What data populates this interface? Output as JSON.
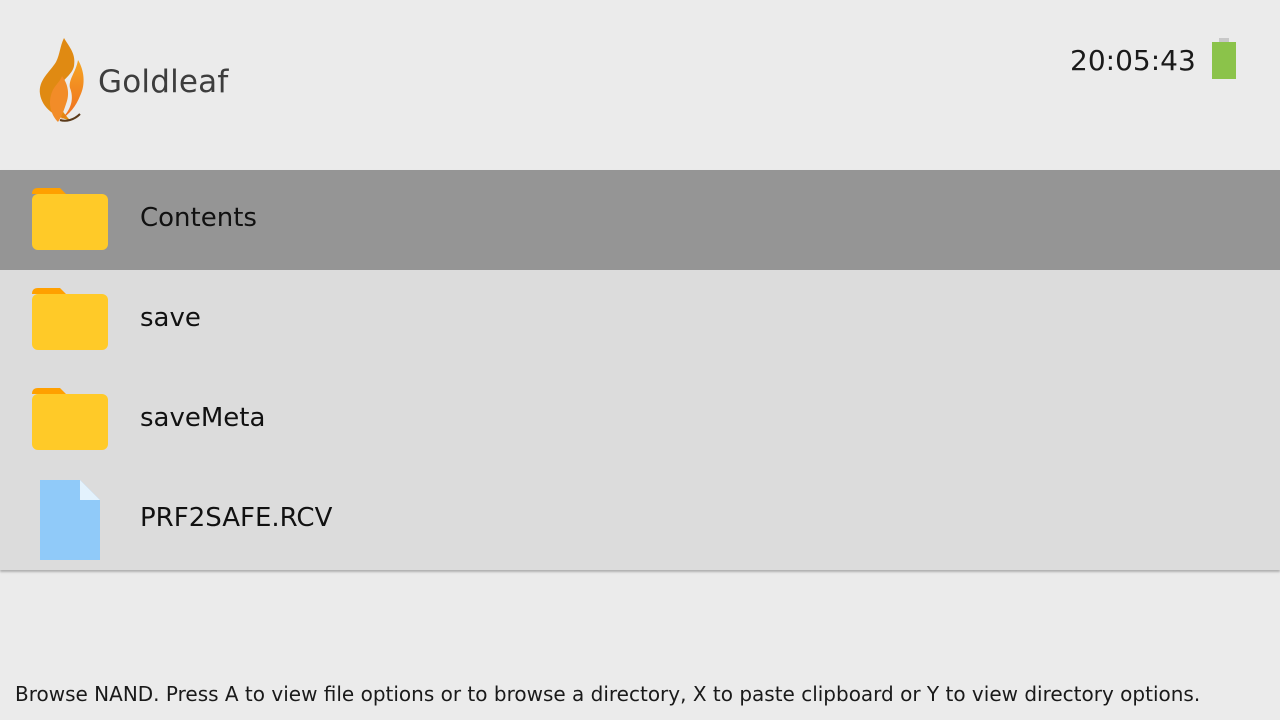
{
  "header": {
    "app_title": "Goldleaf",
    "logo_icon": "goldleaf-flame-logo",
    "clock": "20:05:43",
    "battery_icon": "battery-full-icon",
    "battery_color": "#8bc34a"
  },
  "browser": {
    "items": [
      {
        "name": "Contents",
        "type": "folder",
        "icon": "folder-icon",
        "selected": true
      },
      {
        "name": "save",
        "type": "folder",
        "icon": "folder-icon",
        "selected": false
      },
      {
        "name": "saveMeta",
        "type": "folder",
        "icon": "folder-icon",
        "selected": false
      },
      {
        "name": "PRF2SAFE.RCV",
        "type": "file",
        "icon": "file-icon",
        "selected": false
      }
    ]
  },
  "footer": {
    "hint": "Browse NAND. Press A to view file options or to browse a directory, X to paste clipboard or Y to view directory options."
  },
  "colors": {
    "selected_row": "#959595",
    "list_background": "#dcdcdc",
    "page_background": "#ebebeb",
    "folder": "#ffca28",
    "folder_tab": "#ffa000",
    "file": "#90caf9"
  }
}
